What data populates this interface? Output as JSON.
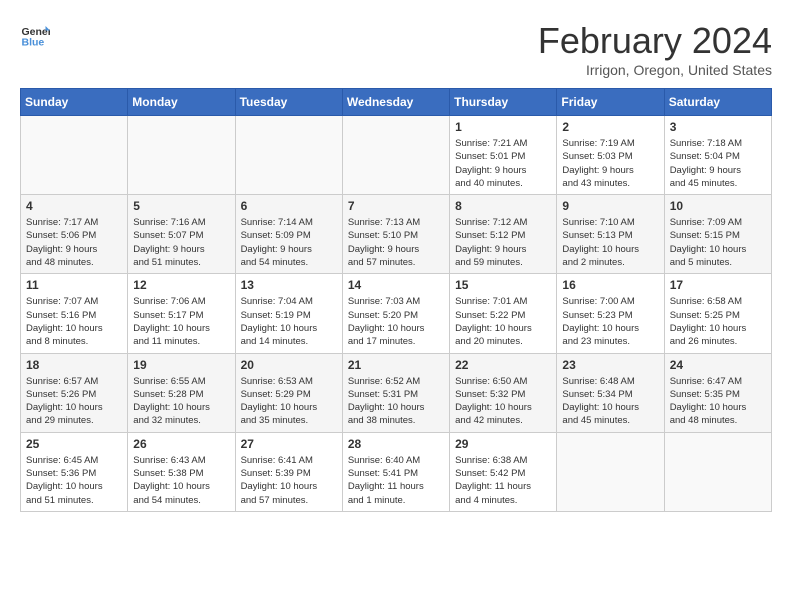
{
  "header": {
    "logo_line1": "General",
    "logo_line2": "Blue",
    "month_title": "February 2024",
    "location": "Irrigon, Oregon, United States"
  },
  "weekdays": [
    "Sunday",
    "Monday",
    "Tuesday",
    "Wednesday",
    "Thursday",
    "Friday",
    "Saturday"
  ],
  "weeks": [
    [
      {
        "day": "",
        "info": ""
      },
      {
        "day": "",
        "info": ""
      },
      {
        "day": "",
        "info": ""
      },
      {
        "day": "",
        "info": ""
      },
      {
        "day": "1",
        "info": "Sunrise: 7:21 AM\nSunset: 5:01 PM\nDaylight: 9 hours\nand 40 minutes."
      },
      {
        "day": "2",
        "info": "Sunrise: 7:19 AM\nSunset: 5:03 PM\nDaylight: 9 hours\nand 43 minutes."
      },
      {
        "day": "3",
        "info": "Sunrise: 7:18 AM\nSunset: 5:04 PM\nDaylight: 9 hours\nand 45 minutes."
      }
    ],
    [
      {
        "day": "4",
        "info": "Sunrise: 7:17 AM\nSunset: 5:06 PM\nDaylight: 9 hours\nand 48 minutes."
      },
      {
        "day": "5",
        "info": "Sunrise: 7:16 AM\nSunset: 5:07 PM\nDaylight: 9 hours\nand 51 minutes."
      },
      {
        "day": "6",
        "info": "Sunrise: 7:14 AM\nSunset: 5:09 PM\nDaylight: 9 hours\nand 54 minutes."
      },
      {
        "day": "7",
        "info": "Sunrise: 7:13 AM\nSunset: 5:10 PM\nDaylight: 9 hours\nand 57 minutes."
      },
      {
        "day": "8",
        "info": "Sunrise: 7:12 AM\nSunset: 5:12 PM\nDaylight: 9 hours\nand 59 minutes."
      },
      {
        "day": "9",
        "info": "Sunrise: 7:10 AM\nSunset: 5:13 PM\nDaylight: 10 hours\nand 2 minutes."
      },
      {
        "day": "10",
        "info": "Sunrise: 7:09 AM\nSunset: 5:15 PM\nDaylight: 10 hours\nand 5 minutes."
      }
    ],
    [
      {
        "day": "11",
        "info": "Sunrise: 7:07 AM\nSunset: 5:16 PM\nDaylight: 10 hours\nand 8 minutes."
      },
      {
        "day": "12",
        "info": "Sunrise: 7:06 AM\nSunset: 5:17 PM\nDaylight: 10 hours\nand 11 minutes."
      },
      {
        "day": "13",
        "info": "Sunrise: 7:04 AM\nSunset: 5:19 PM\nDaylight: 10 hours\nand 14 minutes."
      },
      {
        "day": "14",
        "info": "Sunrise: 7:03 AM\nSunset: 5:20 PM\nDaylight: 10 hours\nand 17 minutes."
      },
      {
        "day": "15",
        "info": "Sunrise: 7:01 AM\nSunset: 5:22 PM\nDaylight: 10 hours\nand 20 minutes."
      },
      {
        "day": "16",
        "info": "Sunrise: 7:00 AM\nSunset: 5:23 PM\nDaylight: 10 hours\nand 23 minutes."
      },
      {
        "day": "17",
        "info": "Sunrise: 6:58 AM\nSunset: 5:25 PM\nDaylight: 10 hours\nand 26 minutes."
      }
    ],
    [
      {
        "day": "18",
        "info": "Sunrise: 6:57 AM\nSunset: 5:26 PM\nDaylight: 10 hours\nand 29 minutes."
      },
      {
        "day": "19",
        "info": "Sunrise: 6:55 AM\nSunset: 5:28 PM\nDaylight: 10 hours\nand 32 minutes."
      },
      {
        "day": "20",
        "info": "Sunrise: 6:53 AM\nSunset: 5:29 PM\nDaylight: 10 hours\nand 35 minutes."
      },
      {
        "day": "21",
        "info": "Sunrise: 6:52 AM\nSunset: 5:31 PM\nDaylight: 10 hours\nand 38 minutes."
      },
      {
        "day": "22",
        "info": "Sunrise: 6:50 AM\nSunset: 5:32 PM\nDaylight: 10 hours\nand 42 minutes."
      },
      {
        "day": "23",
        "info": "Sunrise: 6:48 AM\nSunset: 5:34 PM\nDaylight: 10 hours\nand 45 minutes."
      },
      {
        "day": "24",
        "info": "Sunrise: 6:47 AM\nSunset: 5:35 PM\nDaylight: 10 hours\nand 48 minutes."
      }
    ],
    [
      {
        "day": "25",
        "info": "Sunrise: 6:45 AM\nSunset: 5:36 PM\nDaylight: 10 hours\nand 51 minutes."
      },
      {
        "day": "26",
        "info": "Sunrise: 6:43 AM\nSunset: 5:38 PM\nDaylight: 10 hours\nand 54 minutes."
      },
      {
        "day": "27",
        "info": "Sunrise: 6:41 AM\nSunset: 5:39 PM\nDaylight: 10 hours\nand 57 minutes."
      },
      {
        "day": "28",
        "info": "Sunrise: 6:40 AM\nSunset: 5:41 PM\nDaylight: 11 hours\nand 1 minute."
      },
      {
        "day": "29",
        "info": "Sunrise: 6:38 AM\nSunset: 5:42 PM\nDaylight: 11 hours\nand 4 minutes."
      },
      {
        "day": "",
        "info": ""
      },
      {
        "day": "",
        "info": ""
      }
    ]
  ]
}
